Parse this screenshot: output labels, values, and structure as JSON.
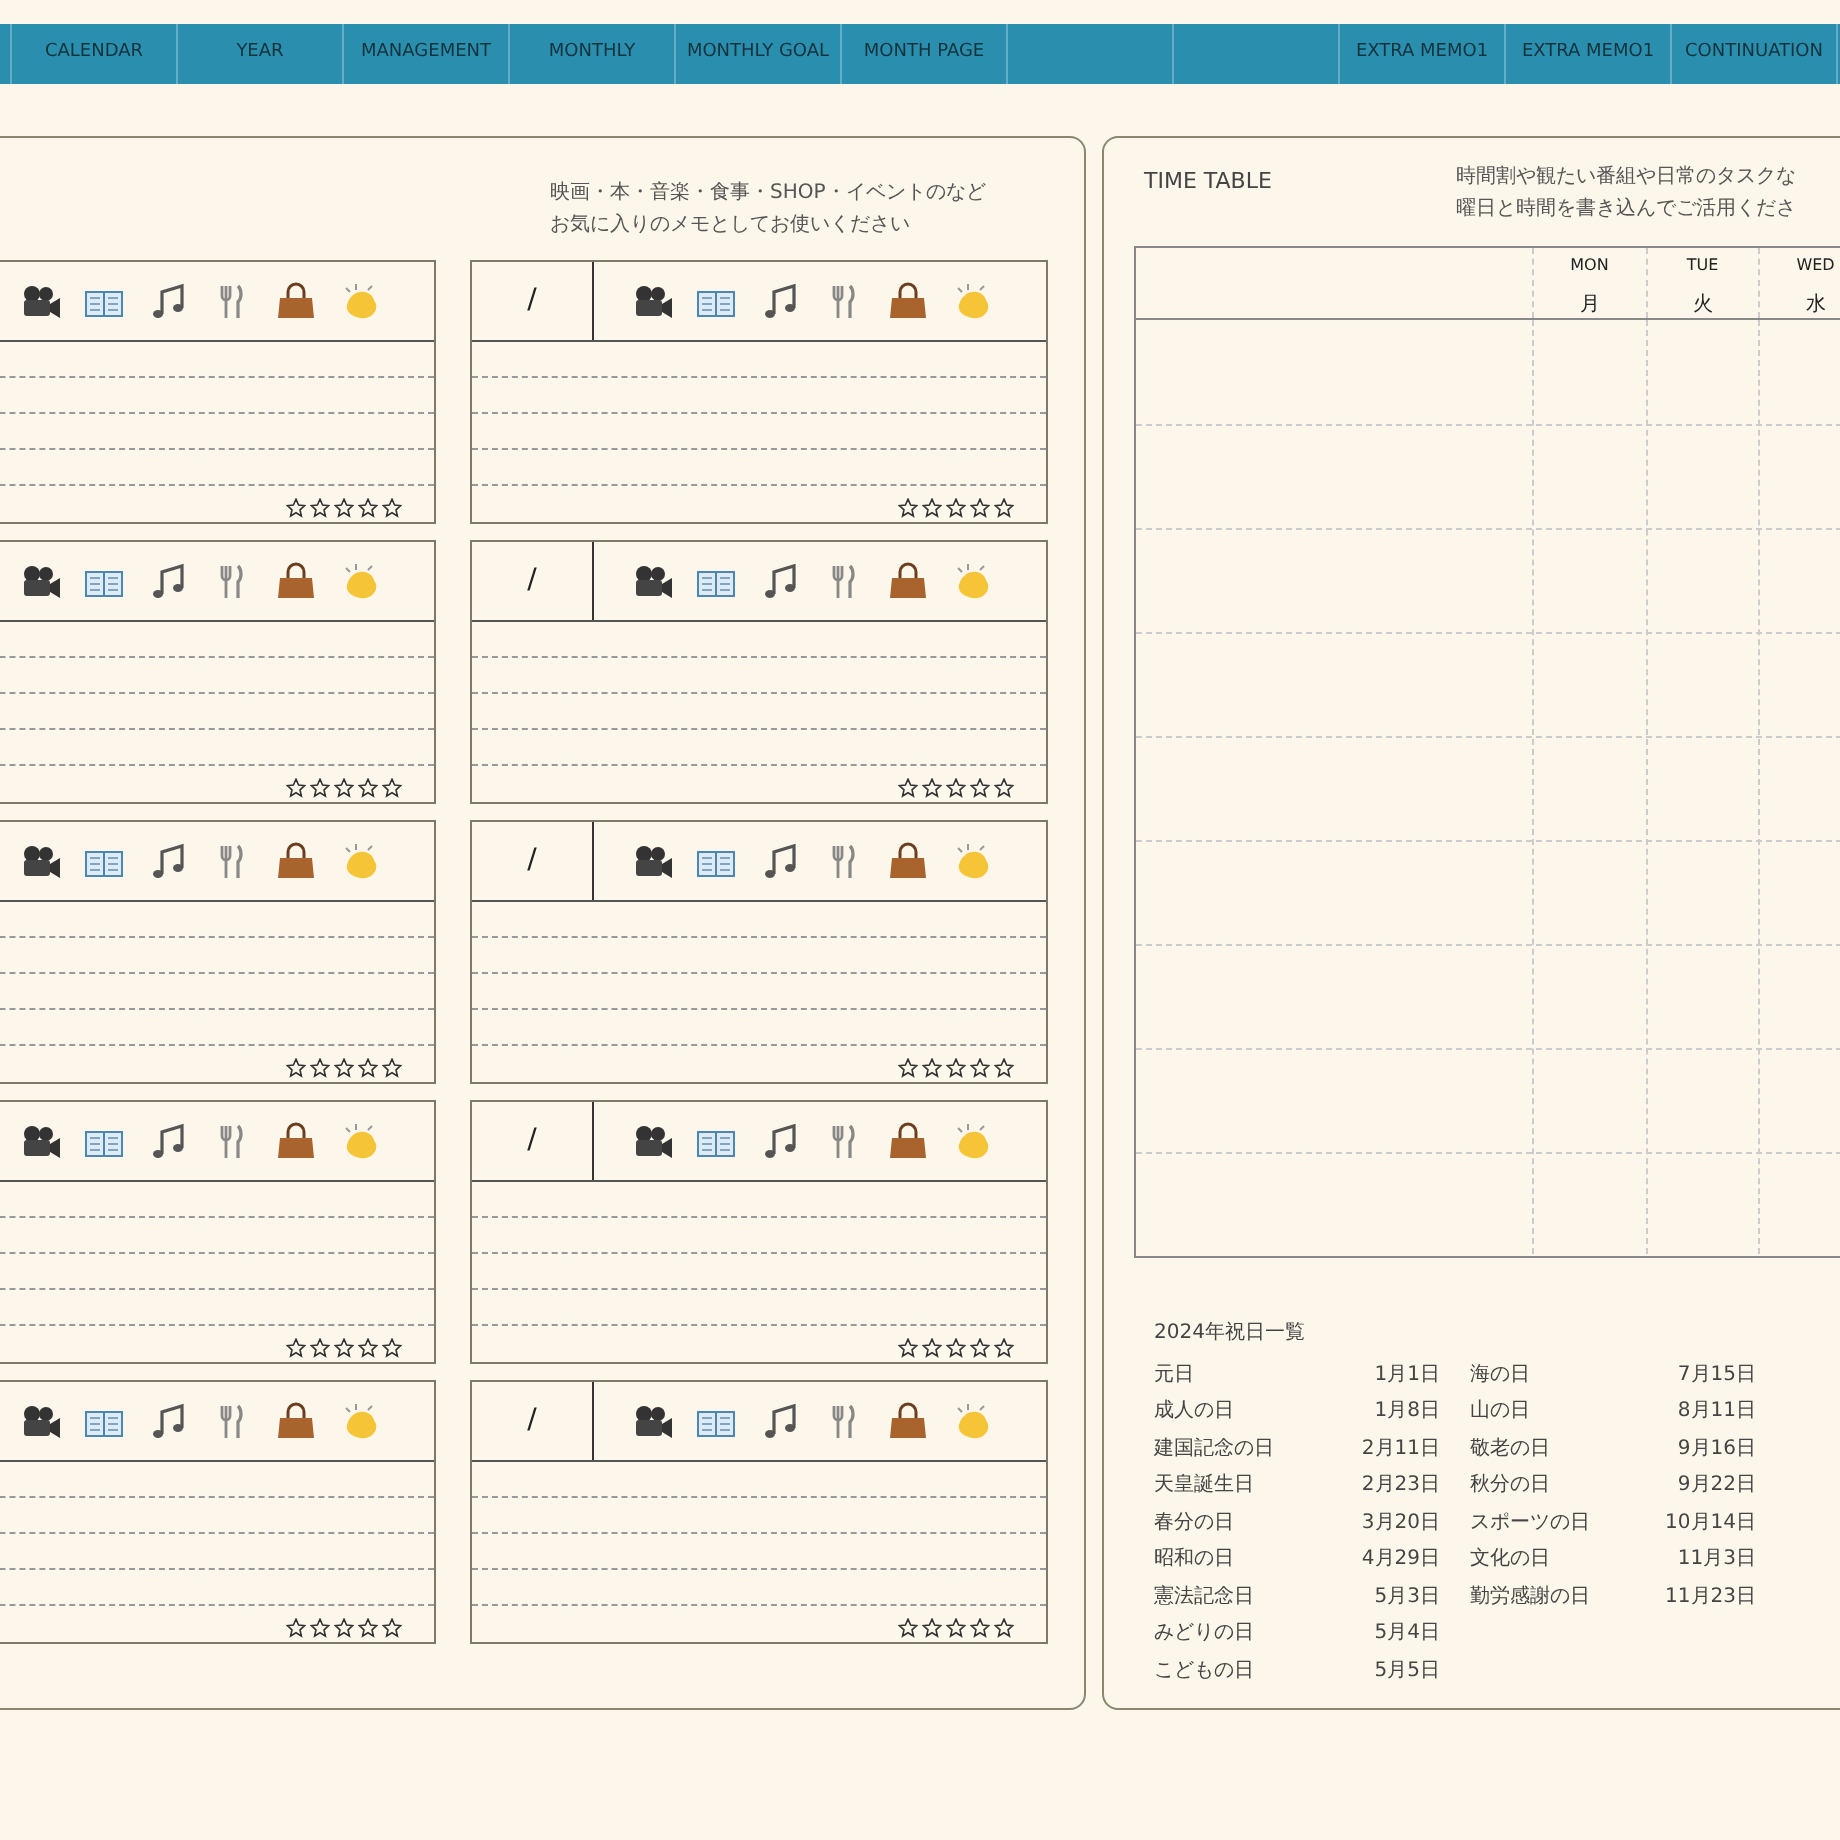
{
  "nav": {
    "tabs": [
      {
        "selected": false
      },
      {
        "label": "CALENDAR",
        "selected": false
      },
      {
        "label": "YEAR",
        "selected": false
      },
      {
        "label": "MANAGEMENT",
        "selected": false
      },
      {
        "label": "MONTHLY",
        "selected": false
      },
      {
        "label": "MONTHLY GOAL",
        "selected": false
      },
      {
        "label": "MONTH PAGE",
        "selected": false
      },
      {
        "selected": false
      },
      {
        "selected": false
      },
      {
        "label": "EXTRA MEMO1",
        "selected": false
      },
      {
        "label": "EXTRA MEMO1",
        "selected": false
      },
      {
        "label": "CONTINUATION",
        "selected": false
      }
    ]
  },
  "memo": {
    "note": [
      "映画・本・音楽・食事・SHOP・イベントのなど",
      "お気に入りのメモとしてお使いください"
    ],
    "cards": [
      {
        "stars": 0
      },
      {
        "date": "/",
        "stars": 0
      },
      {
        "stars": 0
      },
      {
        "date": "/",
        "stars": 0
      },
      {
        "stars": 0
      },
      {
        "date": "/",
        "stars": 0
      },
      {
        "stars": 0
      },
      {
        "date": "/",
        "stars": 0
      },
      {
        "stars": 0
      },
      {
        "date": "/",
        "stars": 0
      }
    ]
  },
  "timetable": {
    "title": "TIME TABLE",
    "note": [
      "時間割や観たい番組や日常のタスクな",
      "曜日と時間を書き込んでご活用くださ"
    ],
    "columns": [
      {
        "en": "MON",
        "ja": "月"
      },
      {
        "en": "TUE",
        "ja": "火"
      },
      {
        "en": "WED",
        "ja": "水"
      }
    ]
  },
  "holidays": {
    "title": "2024年祝日一覧",
    "columns": [
      [
        {
          "name": "元日",
          "date": "1月1日"
        },
        {
          "name": "成人の日",
          "date": "1月8日"
        },
        {
          "name": "建国記念の日",
          "date": "2月11日"
        },
        {
          "name": "天皇誕生日",
          "date": "2月23日"
        },
        {
          "name": "春分の日",
          "date": "3月20日"
        },
        {
          "name": "昭和の日",
          "date": "4月29日"
        },
        {
          "name": "憲法記念日",
          "date": "5月3日"
        },
        {
          "name": "みどりの日",
          "date": "5月4日"
        },
        {
          "name": "こどもの日",
          "date": "5月5日"
        }
      ],
      [
        {
          "name": "海の日",
          "date": "7月15日"
        },
        {
          "name": "山の日",
          "date": "8月11日"
        },
        {
          "name": "敬老の日",
          "date": "9月16日"
        },
        {
          "name": "秋分の日",
          "date": "9月22日"
        },
        {
          "name": "スポーツの日",
          "date": "10月14日"
        },
        {
          "name": "文化の日",
          "date": "11月3日"
        },
        {
          "name": "勤労感謝の日",
          "date": "11月23日"
        }
      ]
    ]
  }
}
